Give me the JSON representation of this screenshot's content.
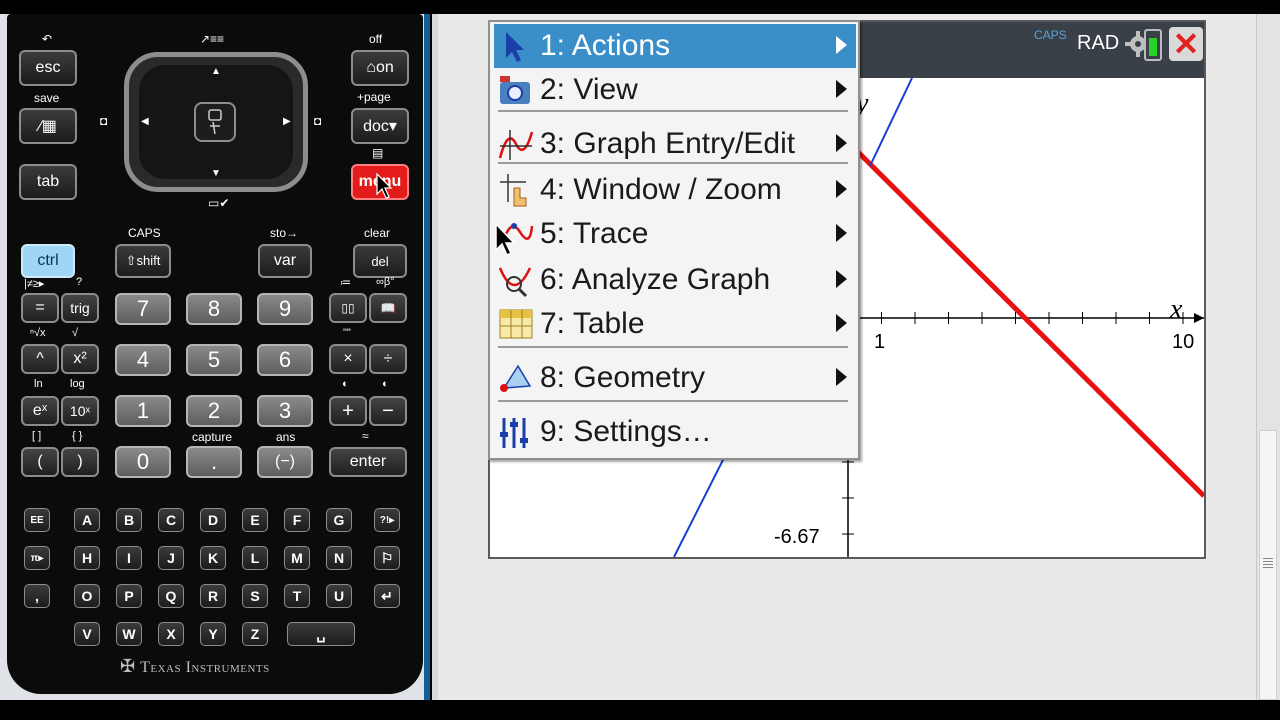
{
  "keypad": {
    "brand": "Texas Instruments",
    "labels": {
      "undo": "↶",
      "scratchpad": "↗≡≡",
      "off": "off",
      "save": "save",
      "add_page": "+page",
      "caps": "CAPS",
      "sto": "sto→",
      "clear": "clear",
      "capture": "capture",
      "ans": "ans",
      "ln": "ln",
      "log": "log",
      "neq": "|≠≥▸",
      "help": "?",
      "eq_frac": "≔",
      "inf": "∞β°",
      "nroot": "ⁿ√x",
      "sqrt": "√",
      "quotes": "\"\"",
      "tri1": "◐",
      "tri2": "◐",
      "brackets": "[ ]",
      "braces": "{ }",
      "approx": "≈"
    },
    "keys": {
      "esc": "esc",
      "on": "on",
      "scratch": "⁄▦",
      "doc": "doc▾",
      "tab": "tab",
      "menu": "menu",
      "ctrl": "ctrl",
      "shift": "⇧shift",
      "var": "var",
      "del": "del",
      "equals": "=",
      "trig": "trig",
      "templates": "▯▯",
      "catalog": "📖",
      "caret": "^",
      "square": "x²",
      "multiply": "×",
      "divide": "÷",
      "exp": "eˣ",
      "pow10": "10ˣ",
      "plus": "+",
      "minus": "−",
      "lparen": "(",
      "rparen": ")",
      "enter": "enter",
      "n7": "7",
      "n8": "8",
      "n9": "9",
      "n4": "4",
      "n5": "5",
      "n6": "6",
      "n1": "1",
      "n2": "2",
      "n3": "3",
      "n0": "0",
      "dot": ".",
      "neg": "(−)",
      "ee": "EE",
      "pi": "π▸",
      "comma": ",",
      "punct": "?!▸",
      "flag": "⚐",
      "return": "↵",
      "space": "␣"
    },
    "alpha_rows": [
      [
        "A",
        "B",
        "C",
        "D",
        "E",
        "F",
        "G"
      ],
      [
        "H",
        "I",
        "J",
        "K",
        "L",
        "M",
        "N"
      ],
      [
        "O",
        "P",
        "Q",
        "R",
        "S",
        "T",
        "U"
      ],
      [
        "V",
        "W",
        "X",
        "Y",
        "Z"
      ]
    ]
  },
  "status_bar": {
    "caps": "CAPS",
    "angle_mode": "RAD",
    "close": "✕",
    "battery_level": 0.75
  },
  "graph": {
    "y_axis_label": "y",
    "x_axis_label": "x",
    "x_tick_1": "1",
    "x_tick_10": "10",
    "y_tick_neg": "-6.67",
    "colors": {
      "f1": "#e81010",
      "f2": "#1a3fd4"
    }
  },
  "menu": {
    "items": [
      {
        "label": "1: Actions",
        "icon": "pointer-arrow-icon",
        "submenu": true,
        "selected": true
      },
      {
        "label": "2: View",
        "icon": "camera-view-icon",
        "submenu": true
      },
      {
        "label": "3: Graph Entry/Edit",
        "icon": "graph-entry-icon",
        "submenu": true
      },
      {
        "label": "4: Window / Zoom",
        "icon": "window-zoom-icon",
        "submenu": true
      },
      {
        "label": "5: Trace",
        "icon": "trace-icon",
        "submenu": true
      },
      {
        "label": "6: Analyze Graph",
        "icon": "analyze-graph-icon",
        "submenu": true
      },
      {
        "label": "7: Table",
        "icon": "table-icon",
        "submenu": true
      },
      {
        "label": "8: Geometry",
        "icon": "geometry-icon",
        "submenu": true
      },
      {
        "label": "9: Settings…",
        "icon": "settings-sliders-icon",
        "submenu": false
      }
    ]
  }
}
